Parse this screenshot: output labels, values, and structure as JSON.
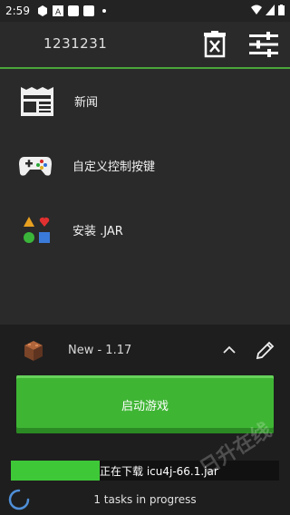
{
  "status_bar": {
    "time": "2:59"
  },
  "toolbar": {
    "title": "1231231"
  },
  "menu": {
    "items": [
      {
        "label": "新闻",
        "icon": "news-icon"
      },
      {
        "label": "自定义控制按键",
        "icon": "gamepad-icon"
      },
      {
        "label": "安装 .JAR",
        "icon": "shapes-icon"
      }
    ]
  },
  "profile": {
    "name": "New - 1.17"
  },
  "launch": {
    "label": "启动游戏"
  },
  "download": {
    "text": "正在下载 icu4j-66.1.jar",
    "progress_percent": 33
  },
  "tasks": {
    "text": "1 tasks in progress"
  },
  "watermark": {
    "text": "日升在线"
  },
  "colors": {
    "accent": "#3fb534",
    "background": "#2a2a2a",
    "bottom_panel": "#1e1e1e"
  }
}
